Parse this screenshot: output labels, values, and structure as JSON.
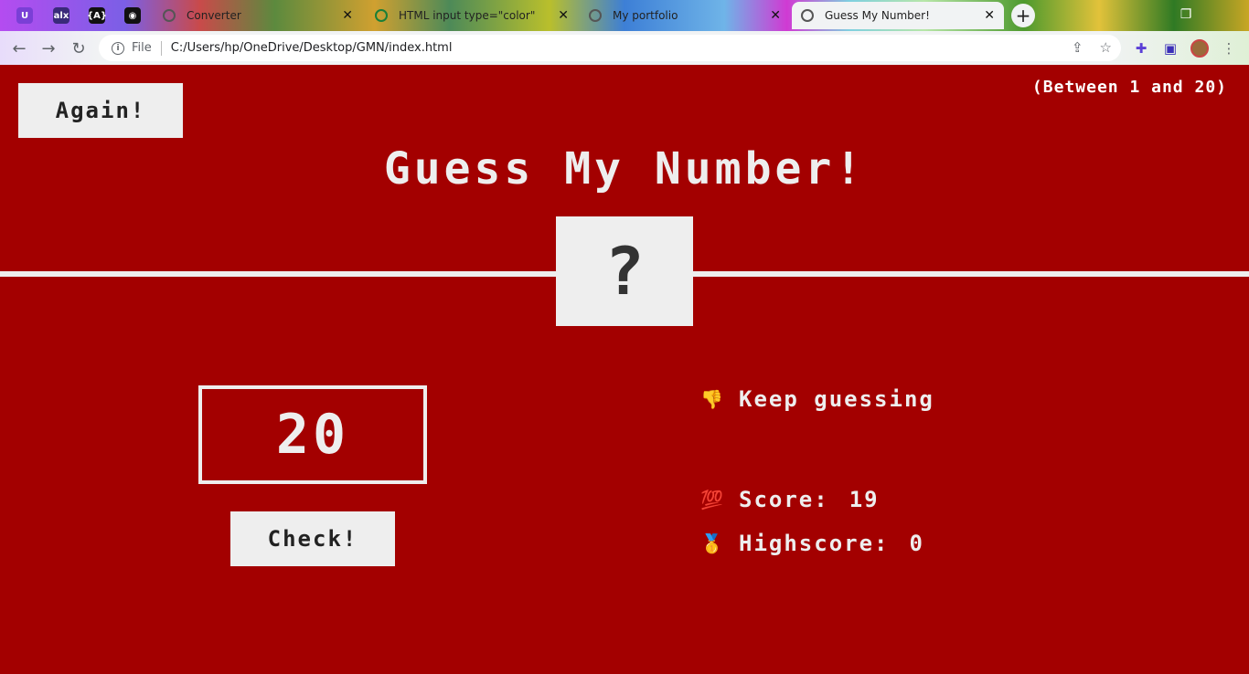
{
  "browser": {
    "pinned_tabs": [
      {
        "icon": "extension-u-icon",
        "glyph": "U",
        "color": "#7a3fd6"
      },
      {
        "icon": "alx-icon",
        "glyph": "alx",
        "color": "#3a2a7a"
      },
      {
        "icon": "code-brackets-icon",
        "glyph": "{A}",
        "color": "#111111"
      },
      {
        "icon": "github-icon",
        "glyph": "◉",
        "color": "#111111"
      }
    ],
    "tabs": [
      {
        "title": "Converter"
      },
      {
        "title": "HTML input type=\"color\""
      },
      {
        "title": "My portfolio"
      },
      {
        "title": "Guess My Number!"
      }
    ],
    "address": {
      "scheme_label": "File",
      "url": "C:/Users/hp/OneDrive/Desktop/GMN/index.html"
    }
  },
  "game": {
    "again_label": "Again!",
    "range_hint": "(Between 1 and 20)",
    "title": "Guess My Number!",
    "secret_display": "?",
    "guess_value": "20",
    "check_label": "Check!",
    "message_emoji": "👎",
    "message": "Keep guessing",
    "score_emoji": "💯",
    "score_label": "Score:",
    "score_value": "19",
    "highscore_emoji": "🥇",
    "highscore_label": "Highscore:",
    "highscore_value": "0"
  },
  "colors": {
    "background": "#a30000",
    "foreground": "#eeeeee",
    "button_text": "#222222"
  }
}
